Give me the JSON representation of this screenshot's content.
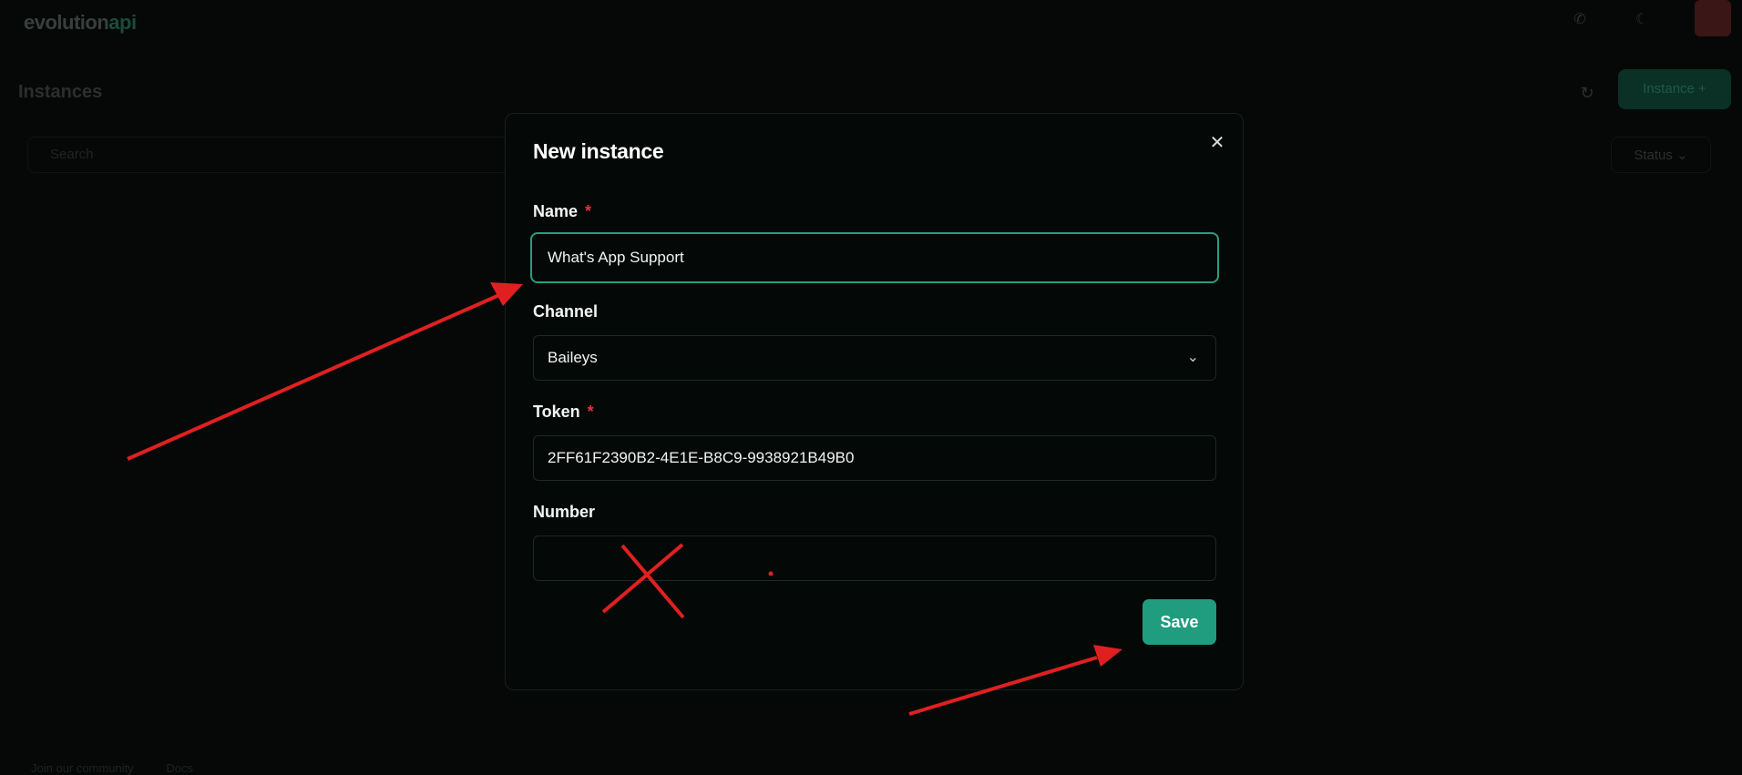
{
  "background": {
    "logo": "evolution",
    "logo_accent": "api",
    "page_title": "Instances",
    "create_button": "Instance +",
    "search_placeholder": "Search",
    "status_filter": "Status ⌄",
    "footer": [
      "Join our community",
      "Docs"
    ]
  },
  "modal": {
    "title": "New instance",
    "close_icon": "close-icon",
    "name": {
      "label": "Name",
      "required_mark": "*",
      "value": "What's App Support"
    },
    "channel": {
      "label": "Channel",
      "value": "Baileys",
      "icon": "chevron-down-icon"
    },
    "token": {
      "label": "Token",
      "required_mark": "*",
      "value": "2FF61F2390B2-4E1E-B8C9-9938921B49B0"
    },
    "number": {
      "label": "Number",
      "value": ""
    },
    "save_label": "Save"
  },
  "colors": {
    "accent": "#1f9d7e",
    "focus_ring": "#2a9d80",
    "required": "#e0333f",
    "annotation": "#e02020"
  }
}
